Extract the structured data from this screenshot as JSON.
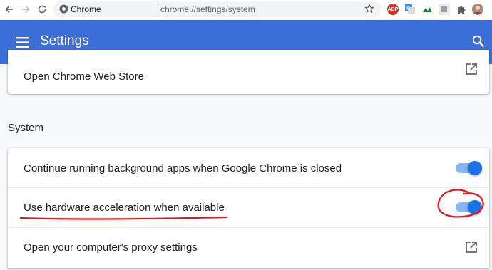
{
  "browser": {
    "site_name": "Chrome",
    "url": "chrome://settings/system",
    "extensions": [
      "adblock-plus-icon",
      "translate-icon",
      "green-chart-icon",
      "gray-extension-icon",
      "puzzle-icon",
      "profile-avatar"
    ],
    "abp_label": "ABP"
  },
  "header": {
    "title": "Settings",
    "color": "#3b6fd5"
  },
  "top_card": {
    "label": "Open Chrome Web Store"
  },
  "system": {
    "section_title": "System",
    "rows": [
      {
        "label": "Continue running background apps when Google Chrome is closed",
        "control": "toggle",
        "enabled": true
      },
      {
        "label": "Use hardware acceleration when available",
        "control": "toggle",
        "enabled": true
      },
      {
        "label": "Open your computer's proxy settings",
        "control": "external-link"
      }
    ]
  },
  "colors": {
    "toggle_knob": "#1a73e8",
    "toggle_track": "#8ab4f8",
    "annotation": "#e8141b"
  }
}
